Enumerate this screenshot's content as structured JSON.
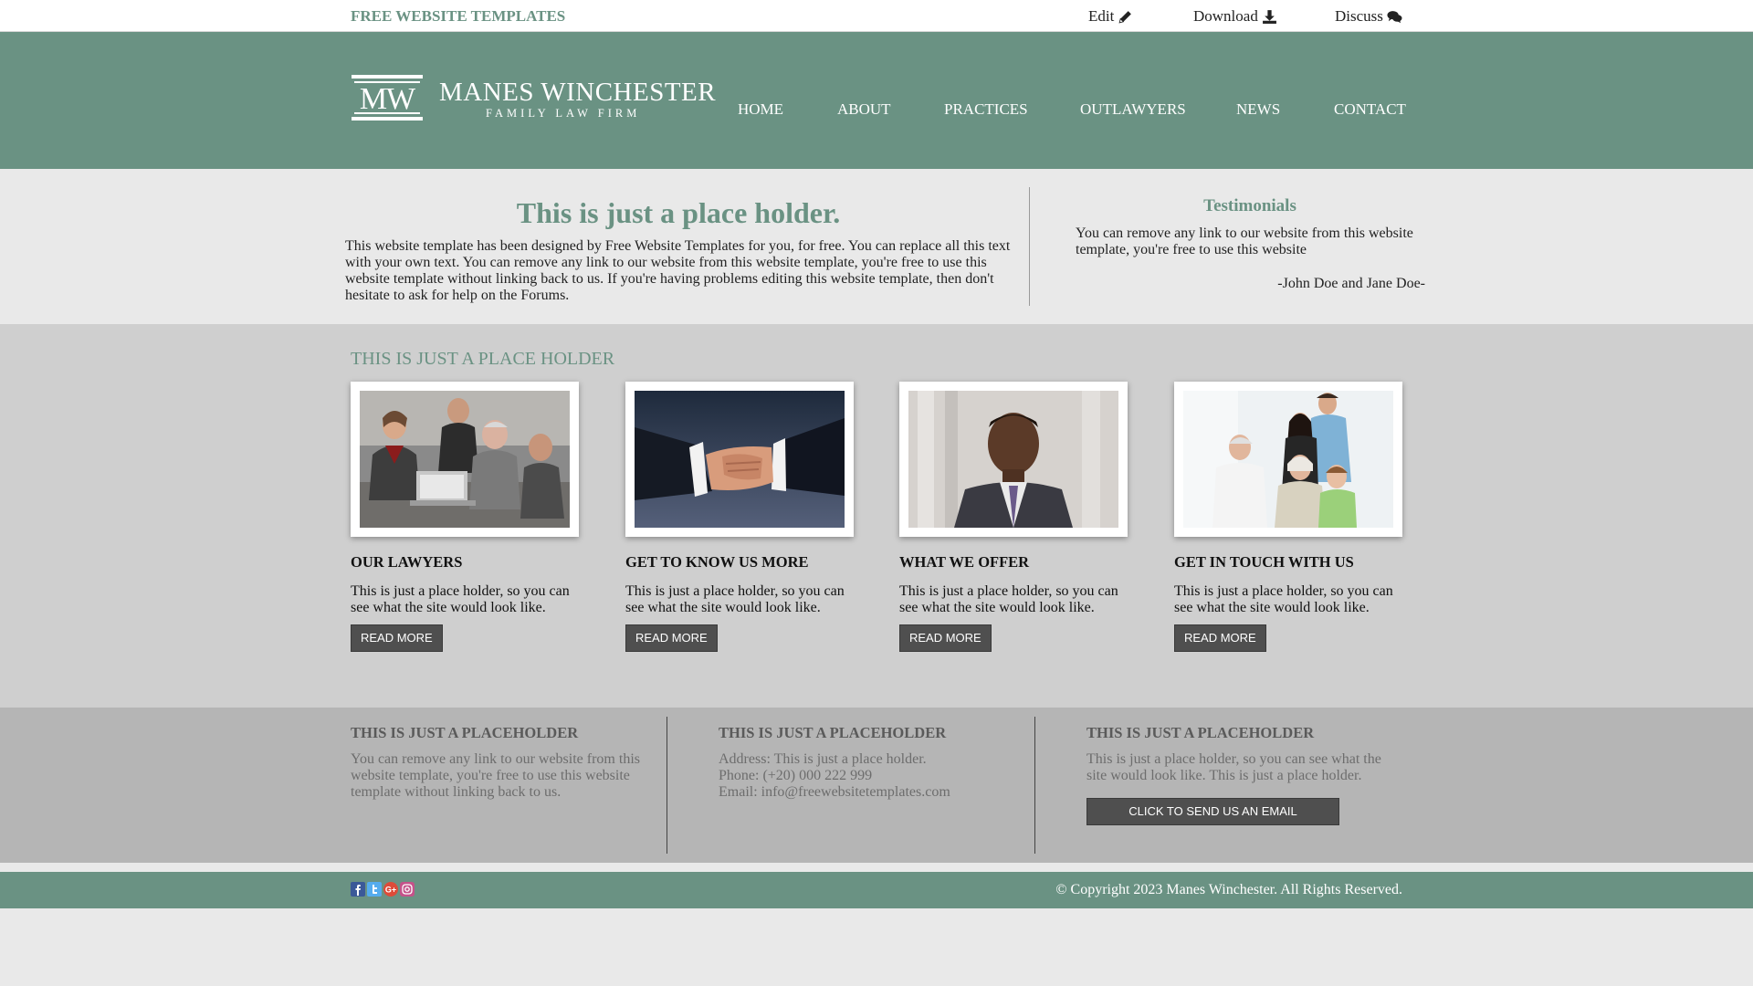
{
  "topbar": {
    "brand": "FREE WEBSITE TEMPLATES",
    "edit": "Edit",
    "download": "Download",
    "discuss": "Discuss",
    "icons": [
      "pencil-icon",
      "download-icon",
      "comments-icon"
    ]
  },
  "header": {
    "logo_mark": "MW",
    "logo_name": "MANES WINCHESTER",
    "logo_sub": "FAMILY LAW FIRM",
    "nav": [
      "HOME",
      "ABOUT",
      "PRACTICES",
      "OUTLAWYERS",
      "NEWS",
      "CONTACT"
    ]
  },
  "intro": {
    "title": "This is just a place holder.",
    "body": "This website template has been designed by Free Website Templates for you, for free. You can replace all this text with your own text. You can remove any link to our website from this website template, you're free to use this website template without linking back to us. If you're having problems editing this website template, then don't hesitate to ask for help on the Forums."
  },
  "testimonials": {
    "title": "Testimonials",
    "text": "You can remove any link to our website from this website template, you're free to use this website",
    "author": "-John Doe and Jane Doe-"
  },
  "cards_section": {
    "heading": "THIS IS JUST A PLACE HOLDER",
    "cards": [
      {
        "title": "OUR LAWYERS",
        "text": "This is just a place holder, so you can see what the site would look like.",
        "button": "READ MORE",
        "image": "meeting-photo"
      },
      {
        "title": "GET TO KNOW US MORE",
        "text": "This is just a place holder, so you can see what the site would look like.",
        "button": "READ MORE",
        "image": "handshake-photo"
      },
      {
        "title": "WHAT WE OFFER",
        "text": "This is just a place holder, so you can see what the site would look like.",
        "button": "READ MORE",
        "image": "businessman-photo"
      },
      {
        "title": "GET IN TOUCH WITH US",
        "text": "This is just a place holder, so you can see what the site would look like.",
        "button": "READ MORE",
        "image": "family-photo"
      }
    ]
  },
  "footer_info": {
    "col1": {
      "title": "THIS IS JUST A PLACEHOLDER",
      "text": "You can remove any link to our website from this website template, you're free to use this website template without linking back to us."
    },
    "col2": {
      "title": "THIS IS JUST A PLACEHOLDER",
      "address": "Address: This is just a place holder.",
      "phone": "Phone: (+20) 000 222 999",
      "email": "Email: info@freewebsitetemplates.com"
    },
    "col3": {
      "title": "THIS IS JUST A PLACEHOLDER",
      "text": "This is just a place holder, so you can see what the site would look like. This is just a place holder.",
      "button": "CLICK TO SEND US AN EMAIL"
    }
  },
  "copybar": {
    "social": [
      "facebook-icon",
      "twitter-icon",
      "googleplus-icon",
      "instagram-icon"
    ],
    "copyright": "© Copyright 2023 Manes Winchester. All Rights Reserved."
  },
  "colors": {
    "accent": "#6a9283",
    "button": "#4f4f4f",
    "cards_bg": "#cfcfcf",
    "footer_bg": "#b5b5b5"
  }
}
